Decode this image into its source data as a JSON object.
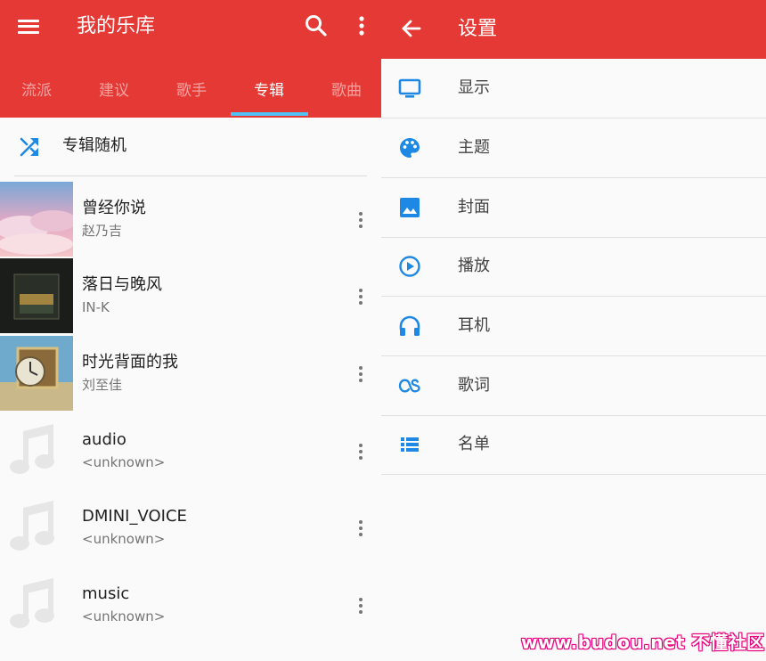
{
  "library": {
    "title": "我的乐库",
    "tabs": [
      {
        "label": "流派",
        "active": false
      },
      {
        "label": "建议",
        "active": false
      },
      {
        "label": "歌手",
        "active": false
      },
      {
        "label": "专辑",
        "active": true
      },
      {
        "label": "歌曲",
        "active": false
      }
    ],
    "shuffle_label": "专辑随机",
    "albums": [
      {
        "title": "曾经你说",
        "artist": "赵乃吉",
        "art": "album-cover-clouds"
      },
      {
        "title": "落日与晚风",
        "artist": "IN-K",
        "art": "album-cover-dark"
      },
      {
        "title": "时光背面的我",
        "artist": "刘至佳",
        "art": "album-cover-clock"
      },
      {
        "title": "audio",
        "artist": "<unknown>",
        "art": "music-note-placeholder"
      },
      {
        "title": "DMINI_VOICE",
        "artist": "<unknown>",
        "art": "music-note-placeholder"
      },
      {
        "title": "music",
        "artist": "<unknown>",
        "art": "music-note-placeholder"
      }
    ]
  },
  "settings": {
    "title": "设置",
    "items": [
      {
        "label": "显示",
        "icon": "monitor-icon"
      },
      {
        "label": "主题",
        "icon": "palette-icon"
      },
      {
        "label": "封面",
        "icon": "image-icon"
      },
      {
        "label": "播放",
        "icon": "play-circle-icon"
      },
      {
        "label": "耳机",
        "icon": "headphones-icon"
      },
      {
        "label": "歌词",
        "icon": "lastfm-icon"
      },
      {
        "label": "名单",
        "icon": "list-icon"
      }
    ]
  },
  "watermark": "www.budou.net 不懂社区",
  "colors": {
    "appbar": "#e53935",
    "accent": "#4fc3f7",
    "icon": "#1e88e5"
  }
}
